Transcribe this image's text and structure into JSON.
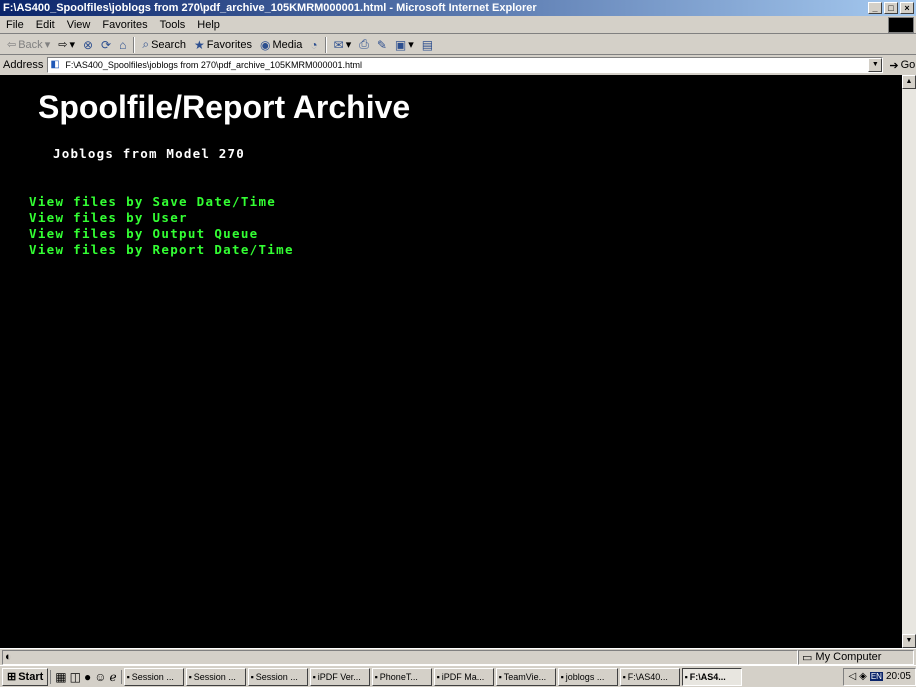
{
  "window": {
    "title": "F:\\AS400_Spoolfiles\\joblogs from 270\\pdf_archive_105KMRM000001.html - Microsoft Internet Explorer",
    "min": "_",
    "max": "□",
    "close": "×"
  },
  "menu": [
    "File",
    "Edit",
    "View",
    "Favorites",
    "Tools",
    "Help"
  ],
  "toolbar": {
    "back": "Back",
    "search": "Search",
    "favorites": "Favorites",
    "media": "Media"
  },
  "address": {
    "label": "Address",
    "value": "F:\\AS400_Spoolfiles\\joblogs from 270\\pdf_archive_105KMRM000001.html",
    "go": "Go"
  },
  "page": {
    "heading": "Spoolfile/Report Archive",
    "subheading": "Joblogs from Model 270",
    "links": [
      "View files by Save Date/Time",
      "View files by User",
      "View files by Output Queue",
      "View files by Report Date/Time"
    ]
  },
  "status": {
    "zone": "My Computer"
  },
  "taskbar": {
    "start": "Start",
    "tasks": [
      {
        "label": "Session ...",
        "icon": "terminal-icon"
      },
      {
        "label": "Session ...",
        "icon": "terminal-icon"
      },
      {
        "label": "Session ...",
        "icon": "terminal-icon"
      },
      {
        "label": "iPDF Ver...",
        "icon": "folder-icon"
      },
      {
        "label": "PhoneT...",
        "icon": "app-icon"
      },
      {
        "label": "iPDF Ma...",
        "icon": "app-icon"
      },
      {
        "label": "TeamVie...",
        "icon": "teamviewer-icon"
      },
      {
        "label": "joblogs ...",
        "icon": "folder-icon"
      },
      {
        "label": "F:\\AS40...",
        "icon": "ie-icon"
      },
      {
        "label": "F:\\AS4...",
        "icon": "ie-icon"
      }
    ],
    "lang": "EN",
    "clock": "20:05"
  }
}
